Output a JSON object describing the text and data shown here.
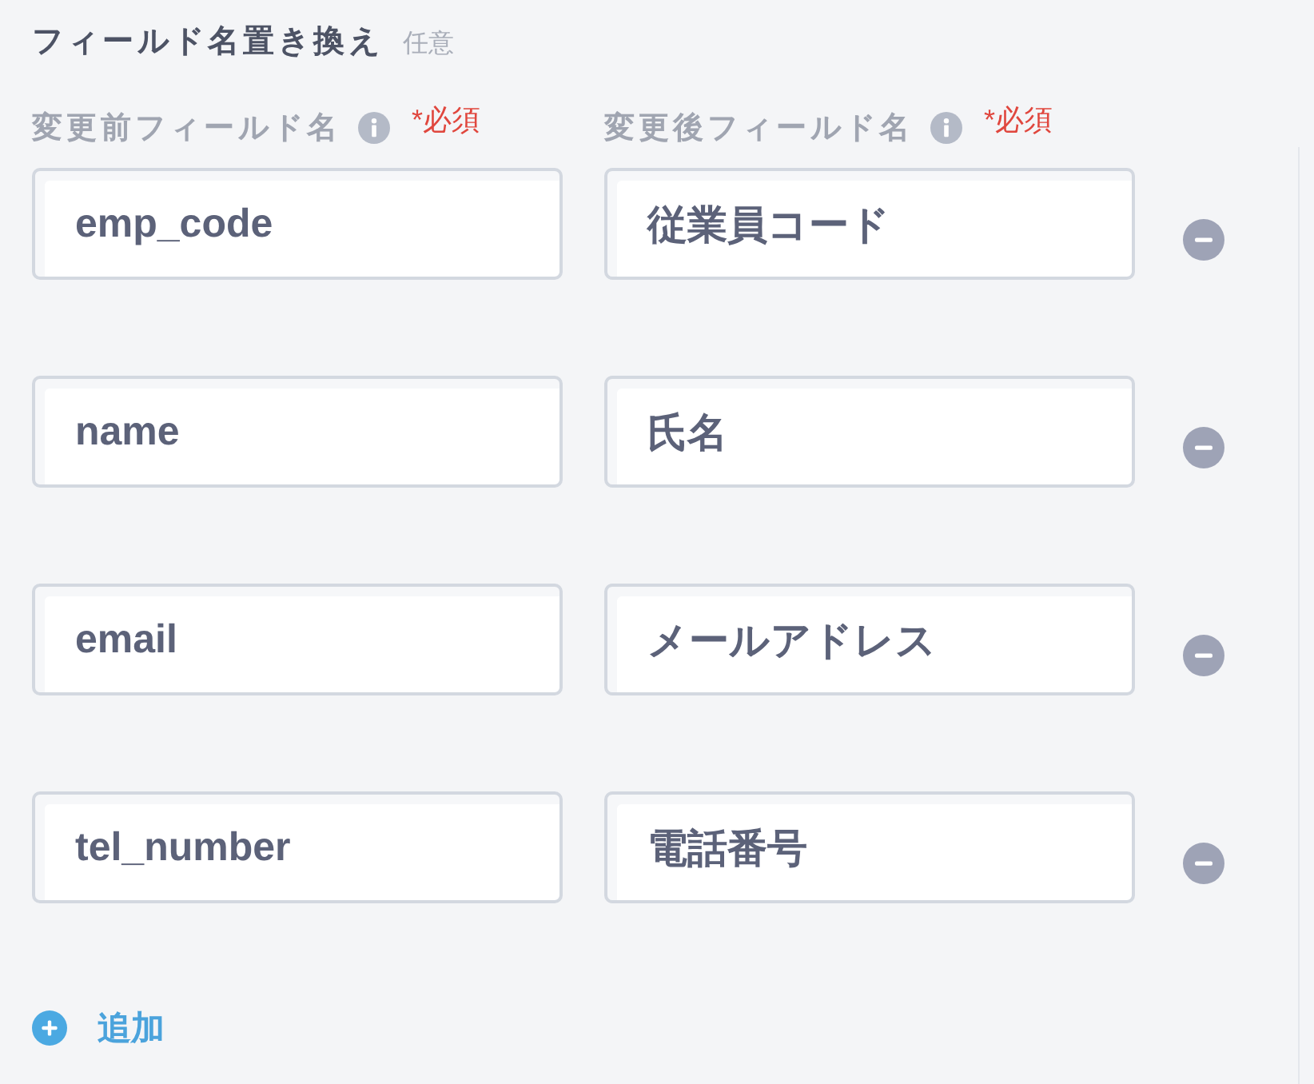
{
  "section": {
    "title": "フィールド名置き換え",
    "optional_tag": "任意"
  },
  "columns": [
    {
      "label": "変更前フィールド名",
      "required": "*必須"
    },
    {
      "label": "変更後フィールド名",
      "required": "*必須"
    }
  ],
  "rows": [
    {
      "before": "emp_code",
      "after": "従業員コード"
    },
    {
      "before": "name",
      "after": "氏名"
    },
    {
      "before": "email",
      "after": "メールアドレス"
    },
    {
      "before": "tel_number",
      "after": "電話番号"
    }
  ],
  "add_button": {
    "label": "追加"
  }
}
